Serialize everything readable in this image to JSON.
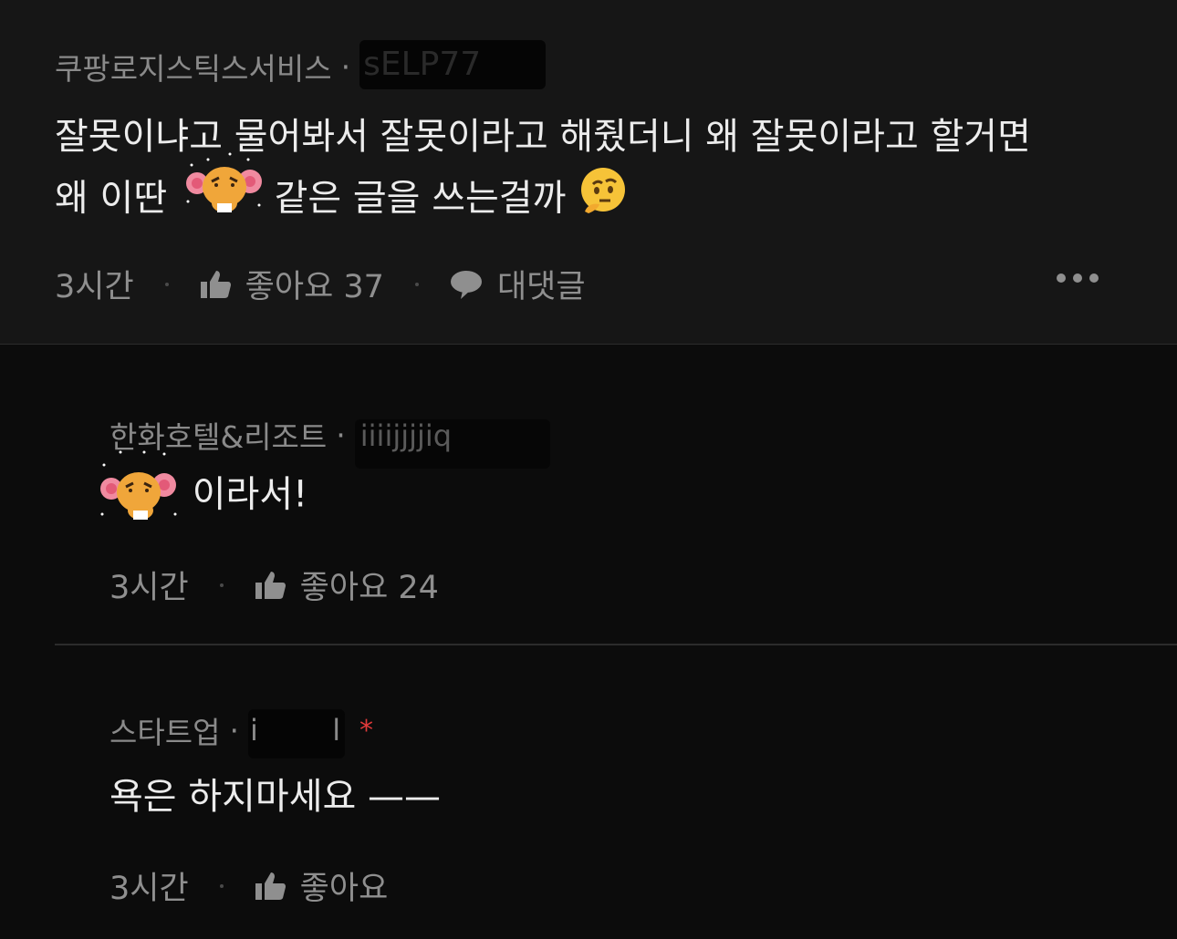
{
  "comments": [
    {
      "company": "쿠팡로지스틱스서비스",
      "separator": "·",
      "username": "sELP77",
      "text_line1": "잘못이냐고 물어봐서 잘못이라고 해줬더니 왜 잘못이라고 할거면",
      "text_line2_a": "왜 이딴",
      "text_line2_b": "같은 글을 쓰는걸까",
      "time": "3시간",
      "like_label": "좋아요 37",
      "reply_label": "대댓글",
      "more_icon": "more-horizontal-icon"
    },
    {
      "company": "한화호텔&리조트",
      "separator": "·",
      "username": "iiiijjjjiq",
      "text": "이라서!",
      "time": "3시간",
      "like_label": "좋아요 24"
    },
    {
      "company": "스타트업",
      "separator": "·",
      "username": "i        l",
      "author_mark": "*",
      "text": "욕은 하지마세요 ——",
      "time": "3시간",
      "like_label": "좋아요"
    }
  ],
  "colors": {
    "background": "#0c0c0c",
    "top_comment_bg": "#161616",
    "meta_text": "#8a8a8a",
    "body_text": "#ececec",
    "author_mark": "#e03a3a"
  }
}
